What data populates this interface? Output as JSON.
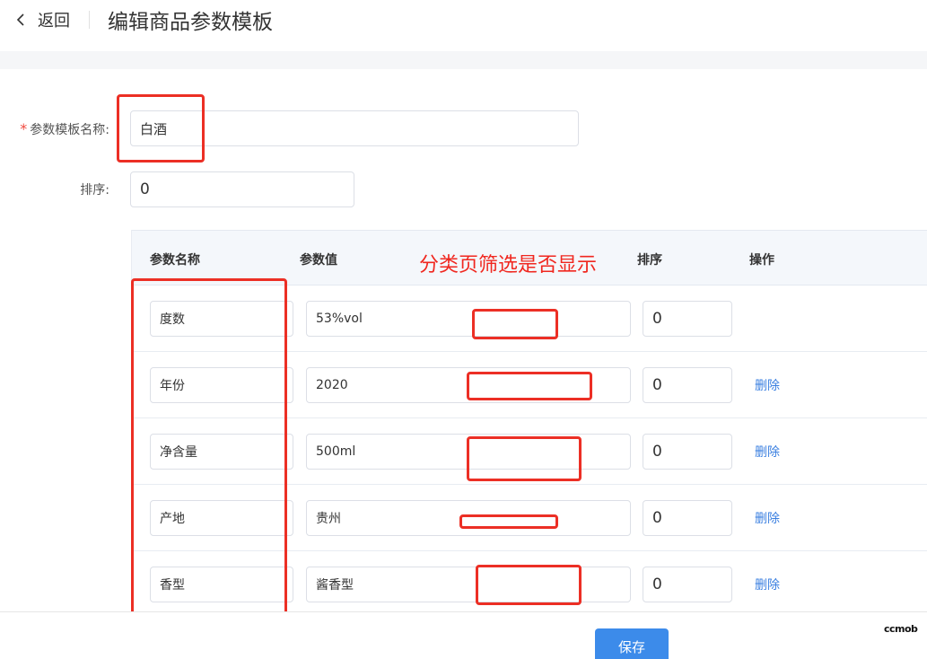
{
  "header": {
    "back_label": "返回",
    "title": "编辑商品参数模板"
  },
  "form": {
    "name_label": "参数模板名称:",
    "name_required_mark": "*",
    "name_value": "白酒",
    "sort_label": "排序:",
    "sort_value": "0"
  },
  "table": {
    "columns": {
      "name": "参数名称",
      "value": "参数值",
      "sort": "排序",
      "action": "操作"
    },
    "rows": [
      {
        "name": "度数",
        "value": "53%vol",
        "sort": "0",
        "action": ""
      },
      {
        "name": "年份",
        "value": "2020",
        "sort": "0",
        "action": "删除"
      },
      {
        "name": "净含量",
        "value": "500ml",
        "sort": "0",
        "action": "删除"
      },
      {
        "name": "产地",
        "value": "贵州",
        "sort": "0",
        "action": "删除"
      },
      {
        "name": "香型",
        "value": "酱香型",
        "sort": "0",
        "action": "删除"
      }
    ]
  },
  "annotation": {
    "text": "分类页筛选是否显示",
    "color": "#f0271f"
  },
  "footer": {
    "save_label": "保存"
  },
  "watermark": "ccmob",
  "colors": {
    "primary": "#3c8bea",
    "link": "#3a7fe0",
    "annotation": "#ec2f25"
  }
}
